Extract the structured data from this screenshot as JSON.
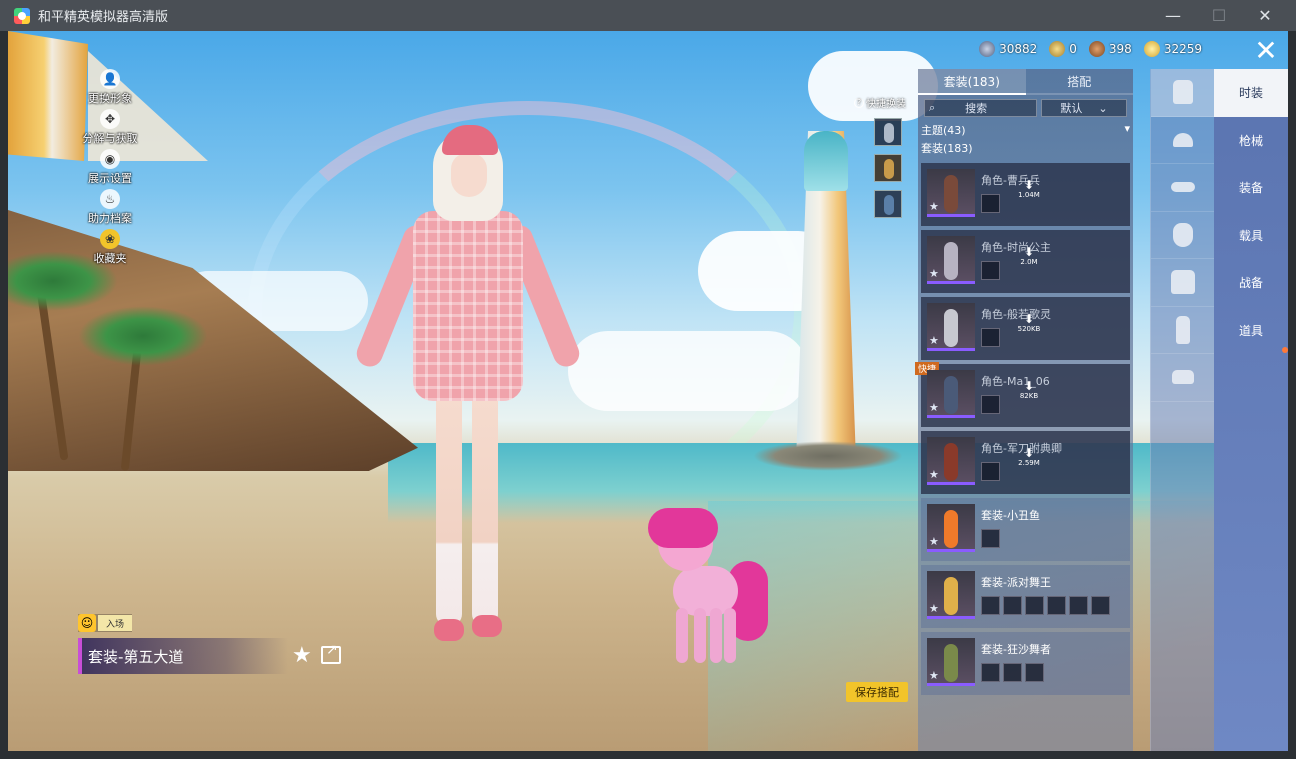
{
  "window": {
    "title": "和平精英模拟器高清版",
    "controls": [
      "—",
      "☐",
      "✕"
    ]
  },
  "left_menu": [
    {
      "label": "更换形象",
      "icon": "avatar-icon"
    },
    {
      "label": "分解与获取",
      "icon": "decompose-icon"
    },
    {
      "label": "展示设置",
      "icon": "eye-icon"
    },
    {
      "label": "助力档案",
      "icon": "flame-icon"
    },
    {
      "label": "收藏夹",
      "icon": "badge-icon"
    }
  ],
  "currency": [
    {
      "value": "30882",
      "color": "#5a6a88",
      "icon": "diamond-coin-icon"
    },
    {
      "value": "0",
      "color": "#c7a04a",
      "icon": "gold-coin-icon"
    },
    {
      "value": "398",
      "color": "#9a6233",
      "icon": "bronze-coin-icon"
    },
    {
      "value": "32259",
      "color": "#e6c04a",
      "icon": "bp-coin-icon"
    }
  ],
  "quick_swap": {
    "label": "快捷换装"
  },
  "outfit_panel": {
    "tabs": [
      {
        "label": "套装(183)",
        "active": true
      },
      {
        "label": "搭配",
        "active": false
      }
    ],
    "search_placeholder": "搜索",
    "sort_label": "默认",
    "theme_label": "主题(43)",
    "suit_label": "套装(183)",
    "items": [
      {
        "name": "角色-曹兵兵",
        "owned": false,
        "size": "1.04M",
        "minis": 1
      },
      {
        "name": "角色-时尚公主",
        "owned": false,
        "size": "2.0M",
        "minis": 1
      },
      {
        "name": "角色-般若歌灵",
        "owned": false,
        "size": "520KB",
        "minis": 1
      },
      {
        "name": "角色-Ma1_06",
        "owned": false,
        "size": "82KB",
        "minis": 1,
        "tag": "快捷"
      },
      {
        "name": "角色-军刀驸典卿",
        "owned": false,
        "size": "2.59M",
        "minis": 1
      },
      {
        "name": "套装-小丑鱼",
        "owned": true,
        "minis": 1
      },
      {
        "name": "套装-派对舞王",
        "owned": true,
        "minis": 6
      },
      {
        "name": "套装-狂沙舞者",
        "owned": true,
        "minis": 3
      }
    ]
  },
  "categories": [
    {
      "icon": "outfit-icon",
      "active": true
    },
    {
      "icon": "hat-icon",
      "active": false
    },
    {
      "icon": "glasses-icon",
      "active": false
    },
    {
      "icon": "mask-icon",
      "active": false
    },
    {
      "icon": "top-icon",
      "active": false
    },
    {
      "icon": "pants-icon",
      "active": false
    },
    {
      "icon": "shoes-icon",
      "active": false
    }
  ],
  "side_tabs": [
    {
      "label": "时装",
      "active": true
    },
    {
      "label": "枪械",
      "active": false
    },
    {
      "label": "装备",
      "active": false
    },
    {
      "label": "载具",
      "active": false
    },
    {
      "label": "战备",
      "active": false
    },
    {
      "label": "道具",
      "active": false
    }
  ],
  "entry": {
    "label": "入场"
  },
  "current_outfit": "套装-第五大道",
  "save_button": "保存搭配"
}
